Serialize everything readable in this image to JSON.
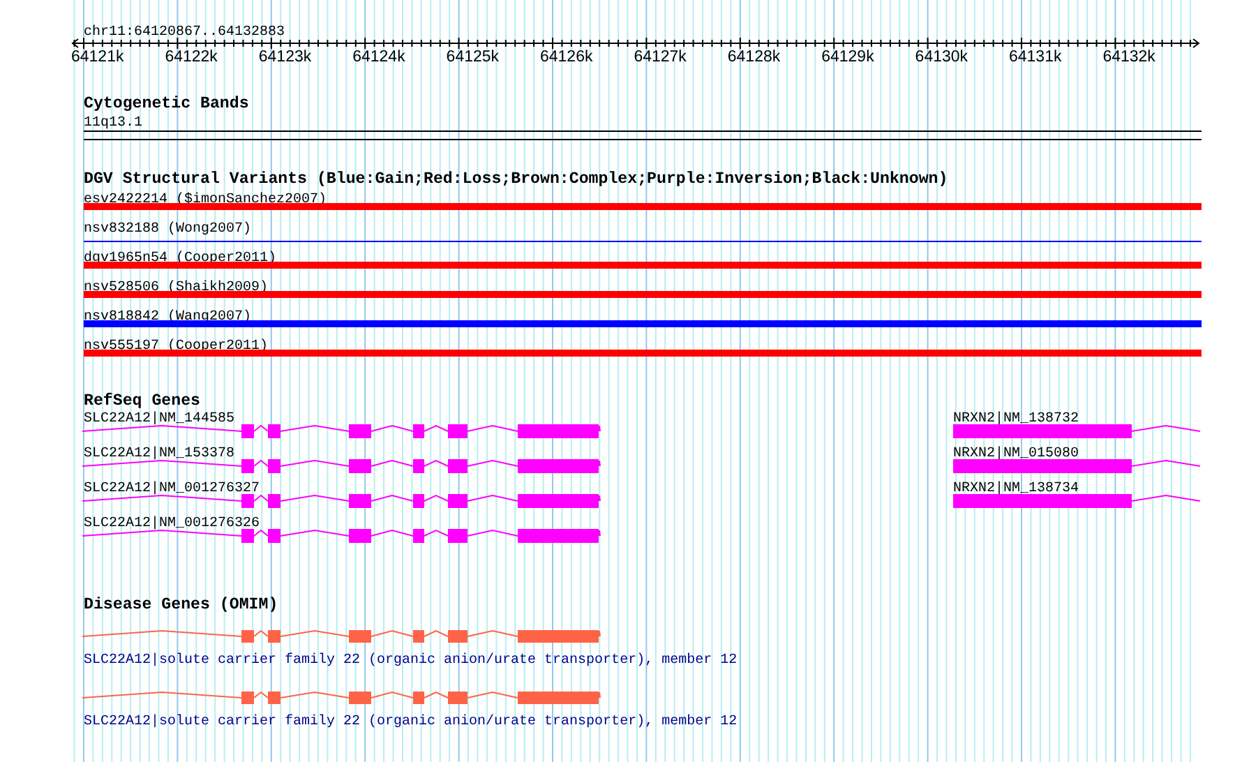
{
  "ruler": {
    "label": "chr11:64120867..64132883",
    "ticks": [
      "64121k",
      "64122k",
      "64123k",
      "64124k",
      "64125k",
      "64126k",
      "64127k",
      "64128k",
      "64129k",
      "64130k",
      "64131k",
      "64132k"
    ]
  },
  "tracks": [
    {
      "kind": "cytoband",
      "title": "Cytogenetic Bands",
      "features": [
        {
          "label": "11q13.1"
        }
      ]
    },
    {
      "kind": "variants",
      "title": "DGV Structural Variants (Blue:Gain;Red:Loss;Brown:Complex;Purple:Inversion;Black:Unknown)",
      "features": [
        {
          "label": "esv2422214 ($imonSanchez2007)",
          "color": "#ff0000",
          "kind": "thick"
        },
        {
          "label": "nsv832188 (Wong2007)",
          "color": "#0000ff",
          "kind": "thin"
        },
        {
          "label": "dgv1965n54 (Cooper2011)",
          "color": "#ff0000",
          "kind": "thick"
        },
        {
          "label": "nsv528506 (Shaikh2009)",
          "color": "#ff0000",
          "kind": "thick"
        },
        {
          "label": "nsv818842 (Wang2007)",
          "color": "#0000ff",
          "kind": "thick"
        },
        {
          "label": "nsv555197 (Cooper2011)",
          "color": "#ff0000",
          "kind": "thick"
        }
      ]
    },
    {
      "kind": "genes",
      "title": "RefSeq Genes",
      "features": [
        {
          "label": "SLC22A12|NM_144585",
          "kind": "left"
        },
        {
          "label": "SLC22A12|NM_153378",
          "kind": "left"
        },
        {
          "label": "SLC22A12|NM_001276327",
          "kind": "left"
        },
        {
          "label": "SLC22A12|NM_001276326",
          "kind": "left"
        },
        {
          "label": "NRXN2|NM_138732",
          "kind": "right"
        },
        {
          "label": "NRXN2|NM_015080",
          "kind": "right"
        },
        {
          "label": "NRXN2|NM_138734",
          "kind": "right"
        }
      ]
    },
    {
      "kind": "omim",
      "title": "Disease Genes (OMIM)",
      "features": [
        {
          "label": "SLC22A12|solute carrier family 22 (organic anion/urate transporter), member 12"
        },
        {
          "label": "SLC22A12|solute carrier family 22 (organic anion/urate transporter), member 12"
        }
      ]
    }
  ]
}
